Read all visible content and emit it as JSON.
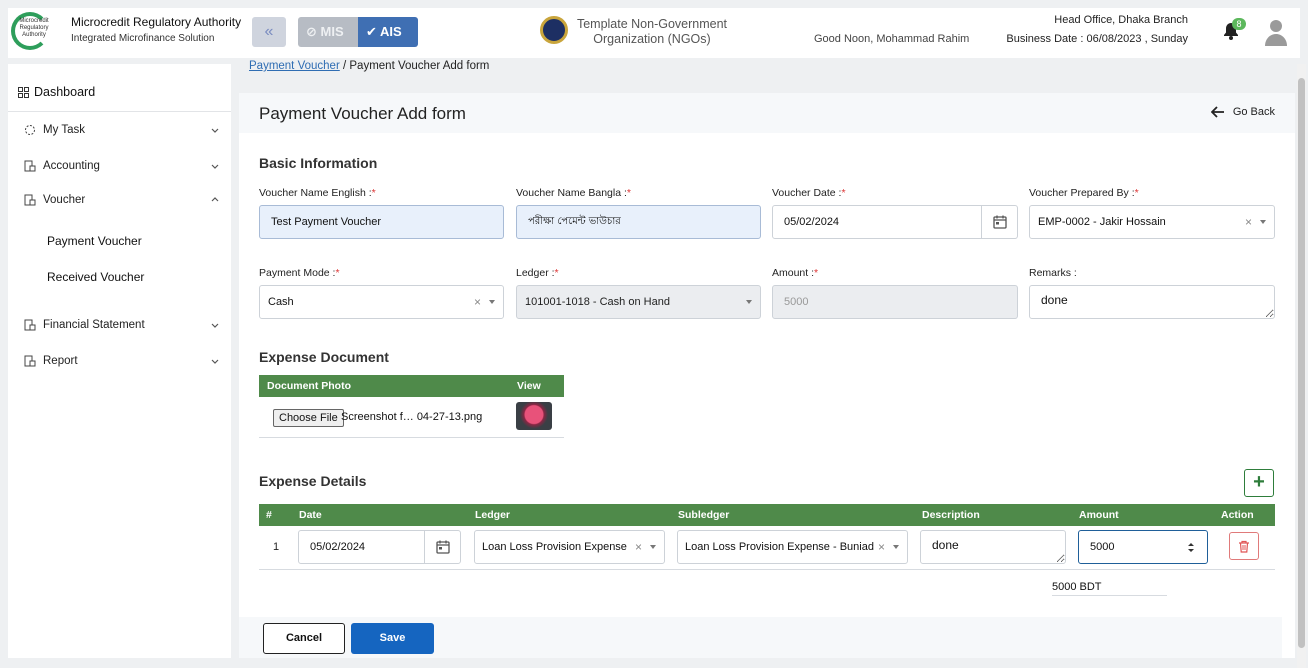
{
  "header": {
    "logo_text": "Microcredit Regulatory Authority",
    "brand_title": "Microcredit Regulatory Authority",
    "brand_subtitle": "Integrated Microfinance Solution",
    "mis_label": "MIS",
    "ais_label": "AIS",
    "org_name": "Template Non-Government Organization (NGOs)",
    "greeting": "Good Noon, Mohammad Rahim",
    "branch": "Head Office, Dhaka Branch",
    "business_date": "Business Date : 06/08/2023 , Sunday",
    "notification_count": "8"
  },
  "sidebar": {
    "dashboard": "Dashboard",
    "items": [
      {
        "label": "My Task",
        "icon": "circle-dashed-icon"
      },
      {
        "label": "Accounting",
        "icon": "ledger-icon"
      },
      {
        "label": "Voucher",
        "icon": "ledger-icon"
      },
      {
        "label": "Financial Statement",
        "icon": "ledger-icon"
      },
      {
        "label": "Report",
        "icon": "ledger-icon"
      }
    ],
    "voucher_sub": [
      "Payment Voucher",
      "Received Voucher"
    ]
  },
  "breadcrumb": {
    "link": "Payment Voucher",
    "separator": "/",
    "current": "Payment Voucher Add form"
  },
  "page": {
    "title": "Payment Voucher Add form",
    "go_back": "Go Back"
  },
  "basic_info": {
    "title": "Basic Information",
    "voucher_name_english": {
      "label": "Voucher Name English :",
      "value": "Test Payment  Voucher"
    },
    "voucher_name_bangla": {
      "label": "Voucher Name Bangla :",
      "value": "পরীক্ষা পেমেন্ট ভাউচার"
    },
    "voucher_date": {
      "label": "Voucher Date :",
      "value": "05/02/2024"
    },
    "prepared_by": {
      "label": "Voucher Prepared By :",
      "value": "EMP-0002 - Jakir Hossain"
    },
    "payment_mode": {
      "label": "Payment Mode :",
      "value": "Cash"
    },
    "ledger": {
      "label": "Ledger :",
      "value": "101001-1018 - Cash on Hand"
    },
    "amount": {
      "label": "Amount :",
      "value": "5000"
    },
    "remarks": {
      "label": "Remarks :",
      "value": "done"
    },
    "required_mark": "*"
  },
  "expense_document": {
    "title": "Expense Document",
    "columns": [
      "Document Photo",
      "View"
    ],
    "choose_file": "Choose File",
    "file_name": "Screenshot f… 04-27-13.png"
  },
  "expense_details": {
    "title": "Expense Details",
    "columns": [
      "#",
      "Date",
      "Ledger",
      "Subledger",
      "Description",
      "Amount",
      "Action"
    ],
    "rows": [
      {
        "index": "1",
        "date": "05/02/2024",
        "ledger": "Loan Loss Provision Expense",
        "subledger": "Loan Loss Provision Expense - Buniad",
        "description": "done",
        "amount": "5000"
      }
    ],
    "total": "5000 BDT"
  },
  "actions": {
    "cancel": "Cancel",
    "save": "Save"
  },
  "colors": {
    "table_header": "#4f8a4a",
    "primary": "#1565c0",
    "accent_blue": "#3f6fb3"
  }
}
